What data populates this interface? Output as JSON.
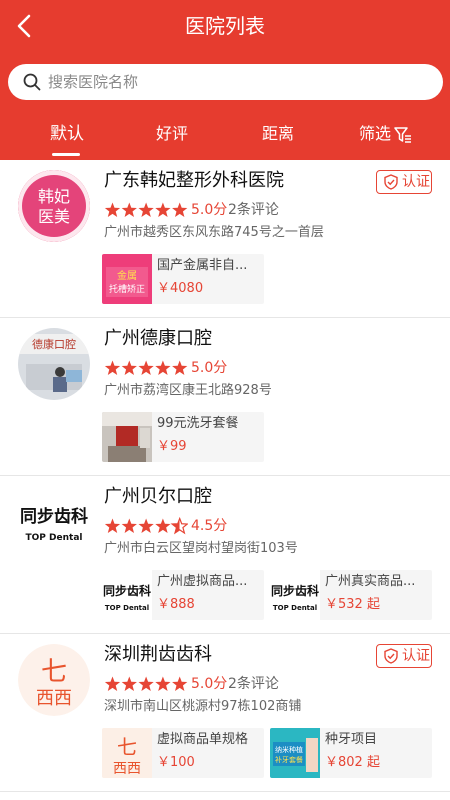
{
  "header": {
    "title": "医院列表",
    "back_icon": "chevron-left-icon",
    "background": "#e63c2f"
  },
  "search": {
    "placeholder": "搜索医院名称",
    "value": ""
  },
  "tabs": [
    {
      "label": "默认",
      "active": true
    },
    {
      "label": "好评",
      "active": false
    },
    {
      "label": "距离",
      "active": false
    },
    {
      "label": "筛选",
      "active": false,
      "icon": "filter-icon"
    }
  ],
  "hospitals": [
    {
      "name": "广东韩妃整形外科医院",
      "certified": true,
      "badge_label": "认证",
      "stars": 5,
      "score": "5.0分",
      "reviews": "2条评论",
      "address": "广州市越秀区东风东路745号之一首层",
      "logo": {
        "line1": "韩妃",
        "line2": "医美"
      },
      "items": [
        {
          "name": "国产金属非自...",
          "price": "￥4080",
          "thumb": {
            "top": "金属",
            "bottom": "托槽矫正"
          }
        }
      ]
    },
    {
      "name": "广州德康口腔",
      "certified": false,
      "stars": 5,
      "score": "5.0分",
      "reviews": "",
      "address": "广州市荔湾区康王北路928号",
      "logo": {
        "sign": "德康口腔"
      },
      "items": [
        {
          "name": "99元洗牙套餐",
          "price": "￥99"
        }
      ]
    },
    {
      "name": "广州贝尔口腔",
      "certified": false,
      "stars": 4.5,
      "score": "4.5分",
      "reviews": "",
      "address": "广州市白云区望岗村望岗街103号",
      "logo": {
        "line1": "同步齿科",
        "line2": "TOP Dental"
      },
      "items": [
        {
          "name": "广州虚拟商品...",
          "price": "￥888",
          "thumb": {
            "line1": "同步齿科",
            "line2": "TOP Dental"
          }
        },
        {
          "name": "广州真实商品...",
          "price": "￥532 起",
          "thumb": {
            "line1": "同步齿科",
            "line2": "TOP Dental"
          }
        }
      ]
    },
    {
      "name": "深圳荆齿齿科",
      "certified": true,
      "badge_label": "认证",
      "stars": 5,
      "score": "5.0分",
      "reviews": "2条评论",
      "address": "深圳市南山区桃源村97栋102商铺",
      "logo": {
        "line1": "七",
        "line2": "西西"
      },
      "items": [
        {
          "name": "虚拟商品单规格",
          "price": "￥100",
          "thumb": {
            "line1": "七",
            "line2": "西西"
          }
        },
        {
          "name": "种牙项目",
          "price": "￥802 起",
          "thumb": {
            "line1": "纳米种植",
            "line2": "补牙套餐"
          }
        }
      ]
    }
  ]
}
